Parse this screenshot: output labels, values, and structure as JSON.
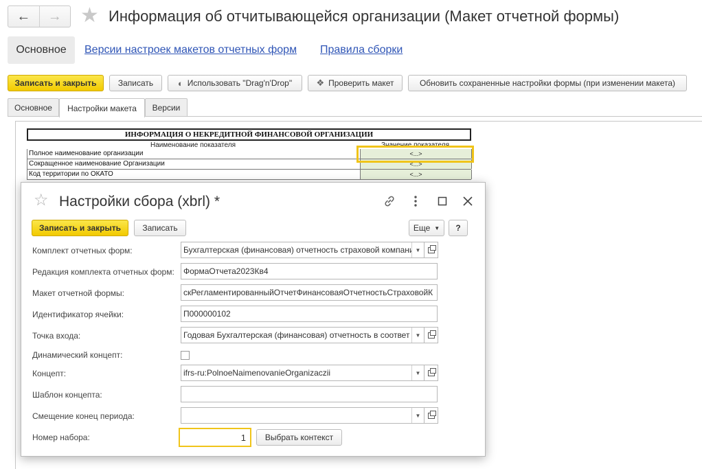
{
  "header": {
    "back_icon": "arrow-left-icon",
    "forward_icon": "arrow-right-icon",
    "favorite_icon": "star-icon",
    "title": "Информация об отчитывающейся организации (Макет отчетной формы)"
  },
  "sections": {
    "main": "Основное",
    "versions_link": "Версии настроек макетов отчетных форм",
    "rules_link": "Правила сборки"
  },
  "toolbar": {
    "save_close": "Записать и закрыть",
    "save": "Записать",
    "dragdrop": "Использовать \"Drag'n'Drop\"",
    "check": "Проверить макет",
    "update": "Обновить сохраненные настройки формы (при изменении макета)",
    "accent_color": "#f2ca00"
  },
  "tabs": {
    "main": "Основное",
    "layout": "Настройки макета",
    "versions": "Версии"
  },
  "sheet": {
    "title": "ИНФОРМАЦИЯ О НЕКРЕДИТНОЙ ФИНАНСОВОЙ ОРГАНИЗАЦИИ",
    "col_name": "Наименование показателя",
    "col_value": "Значение показателя",
    "rows": [
      {
        "label": "Полное наименование организации",
        "value": "<...>"
      },
      {
        "label": "Сокращенное наименование Организации",
        "value": "<...>"
      },
      {
        "label": "Код территории по ОКАТО",
        "value": "<...>"
      }
    ],
    "value_cell_color": "#e6efd9"
  },
  "modal": {
    "title": "Настройки сбора (xbrl) *",
    "save_close": "Записать и закрыть",
    "save": "Записать",
    "more": "Еще",
    "help": "?",
    "fields": {
      "kit_label": "Комплект отчетных форм:",
      "kit_value": "Бухгалтерская (финансовая) отчетность страховой компании",
      "edition_label": "Редакция комплекта отчетных форм:",
      "edition_value": "ФормаОтчета2023Кв4",
      "layout_label": "Макет отчетной формы:",
      "layout_value": "скРегламентированныйОтчетФинансоваяОтчетностьСтраховойК",
      "cell_id_label": "Идентификатор ячейки:",
      "cell_id_value": "П000000102",
      "entry_label": "Точка входа:",
      "entry_value": "Годовая Бухгалтерская (финансовая) отчетность в соответ",
      "dynamic_label": "Динамический концепт:",
      "concept_label": "Концепт:",
      "concept_value": "ifrs-ru:PolnoeNaimenovanieOrganizaczii",
      "template_label": "Шаблон концепта:",
      "template_value": "",
      "offset_label": "Смещение конец периода:",
      "offset_value": "",
      "set_label": "Номер набора:",
      "set_value": "1",
      "choose_context": "Выбрать контекст"
    }
  }
}
